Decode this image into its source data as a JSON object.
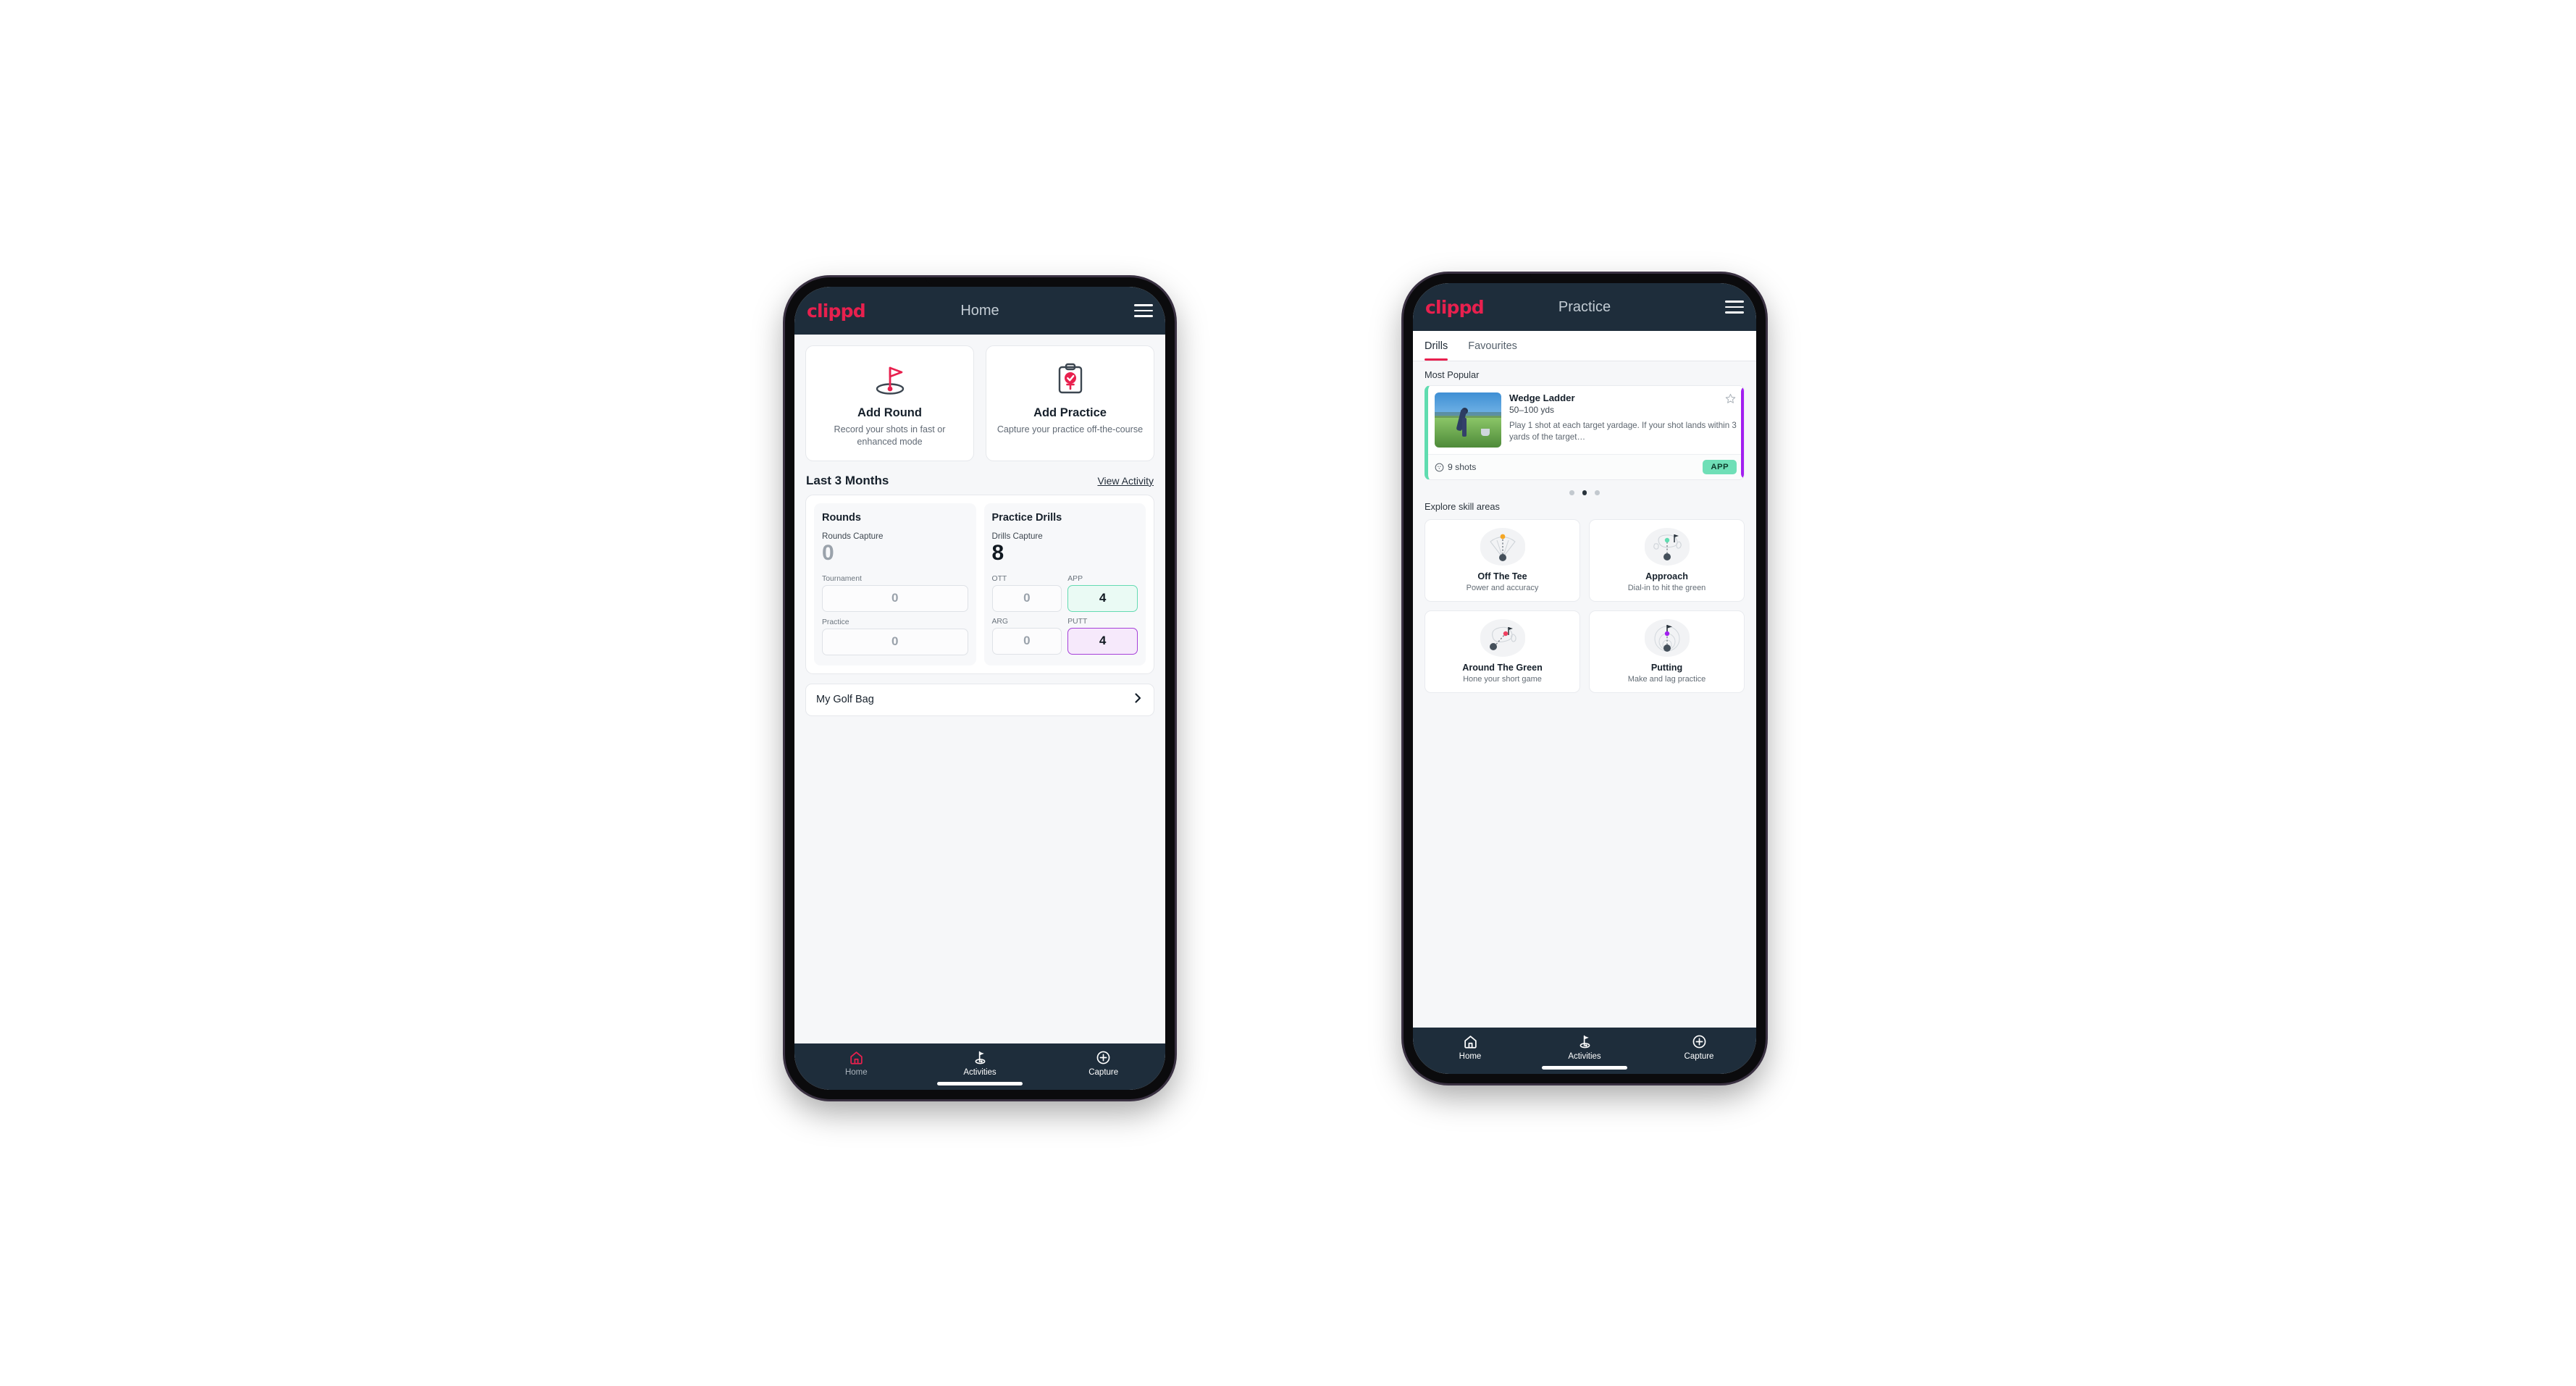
{
  "theme": {
    "brand_pink": "#e8204e",
    "header_dark": "#1e2d3b",
    "accent_green": "#5fdcb0",
    "accent_purple": "#a21ff0",
    "page_bg": "#f6f7f9"
  },
  "phone_home": {
    "appbar": {
      "logo": "clippd",
      "title": "Home",
      "menu_icon": "hamburger-menu-icon"
    },
    "actions": [
      {
        "icon": "golf-flag-hole-icon",
        "title": "Add Round",
        "subtitle": "Record your shots in fast or enhanced mode"
      },
      {
        "icon": "clipboard-check-tee-icon",
        "title": "Add Practice",
        "subtitle": "Capture your practice off-the-course"
      }
    ],
    "section": {
      "title": "Last 3 Months",
      "link": "View Activity"
    },
    "stats": {
      "rounds": {
        "heading": "Rounds",
        "capture_label": "Rounds Capture",
        "capture_value": "0",
        "fields": [
          {
            "label": "Tournament",
            "value": "0",
            "accent": "none"
          },
          {
            "label": "Practice",
            "value": "0",
            "accent": "none"
          }
        ]
      },
      "drills": {
        "heading": "Practice Drills",
        "capture_label": "Drills Capture",
        "capture_value": "8",
        "fields": [
          {
            "label": "OTT",
            "value": "0",
            "accent": "none"
          },
          {
            "label": "APP",
            "value": "4",
            "accent": "green"
          },
          {
            "label": "ARG",
            "value": "0",
            "accent": "none"
          },
          {
            "label": "PUTT",
            "value": "4",
            "accent": "purple"
          }
        ]
      }
    },
    "golf_bag": {
      "label": "My Golf Bag",
      "chevron_icon": "chevron-right-icon"
    },
    "bottom_nav": [
      {
        "icon": "home-icon",
        "label": "Home",
        "active": true
      },
      {
        "icon": "golf-flag-icon",
        "label": "Activities",
        "active": false
      },
      {
        "icon": "plus-circle-icon",
        "label": "Capture",
        "active": false
      }
    ]
  },
  "phone_practice": {
    "appbar": {
      "logo": "clippd",
      "title": "Practice",
      "menu_icon": "hamburger-menu-icon"
    },
    "tabs": [
      {
        "label": "Drills",
        "active": true
      },
      {
        "label": "Favourites",
        "active": false
      }
    ],
    "most_popular_label": "Most Popular",
    "drill": {
      "name": "Wedge Ladder",
      "yardage": "50–100 yds",
      "description": "Play 1 shot at each target yardage. If your shot lands within 3 yards of the target…",
      "shots": "9 shots",
      "shots_icon": "golf-ball-icon",
      "tag": "APP",
      "star_icon": "star-outline-icon",
      "thumb": "golfer-chipping-photo",
      "accent": "#5fdcb0"
    },
    "carousel_dots": {
      "count": 3,
      "active_index": 1
    },
    "skill_section_label": "Explore skill areas",
    "skills": [
      {
        "icon": "tee-shot-fan-icon",
        "title": "Off The Tee",
        "subtitle": "Power and accuracy",
        "dot_color": "#f5a623"
      },
      {
        "icon": "approach-green-icon",
        "title": "Approach",
        "subtitle": "Dial-in to hit the green",
        "dot_color": "#5fdcb0"
      },
      {
        "icon": "chip-green-icon",
        "title": "Around The Green",
        "subtitle": "Hone your short game",
        "dot_color": "#ef4060"
      },
      {
        "icon": "putting-rings-icon",
        "title": "Putting",
        "subtitle": "Make and lag practice",
        "dot_color": "#a21ff0"
      }
    ],
    "bottom_nav": [
      {
        "icon": "home-icon",
        "label": "Home",
        "active": false
      },
      {
        "icon": "golf-flag-icon",
        "label": "Activities",
        "active": false
      },
      {
        "icon": "plus-circle-icon",
        "label": "Capture",
        "active": false
      }
    ]
  }
}
